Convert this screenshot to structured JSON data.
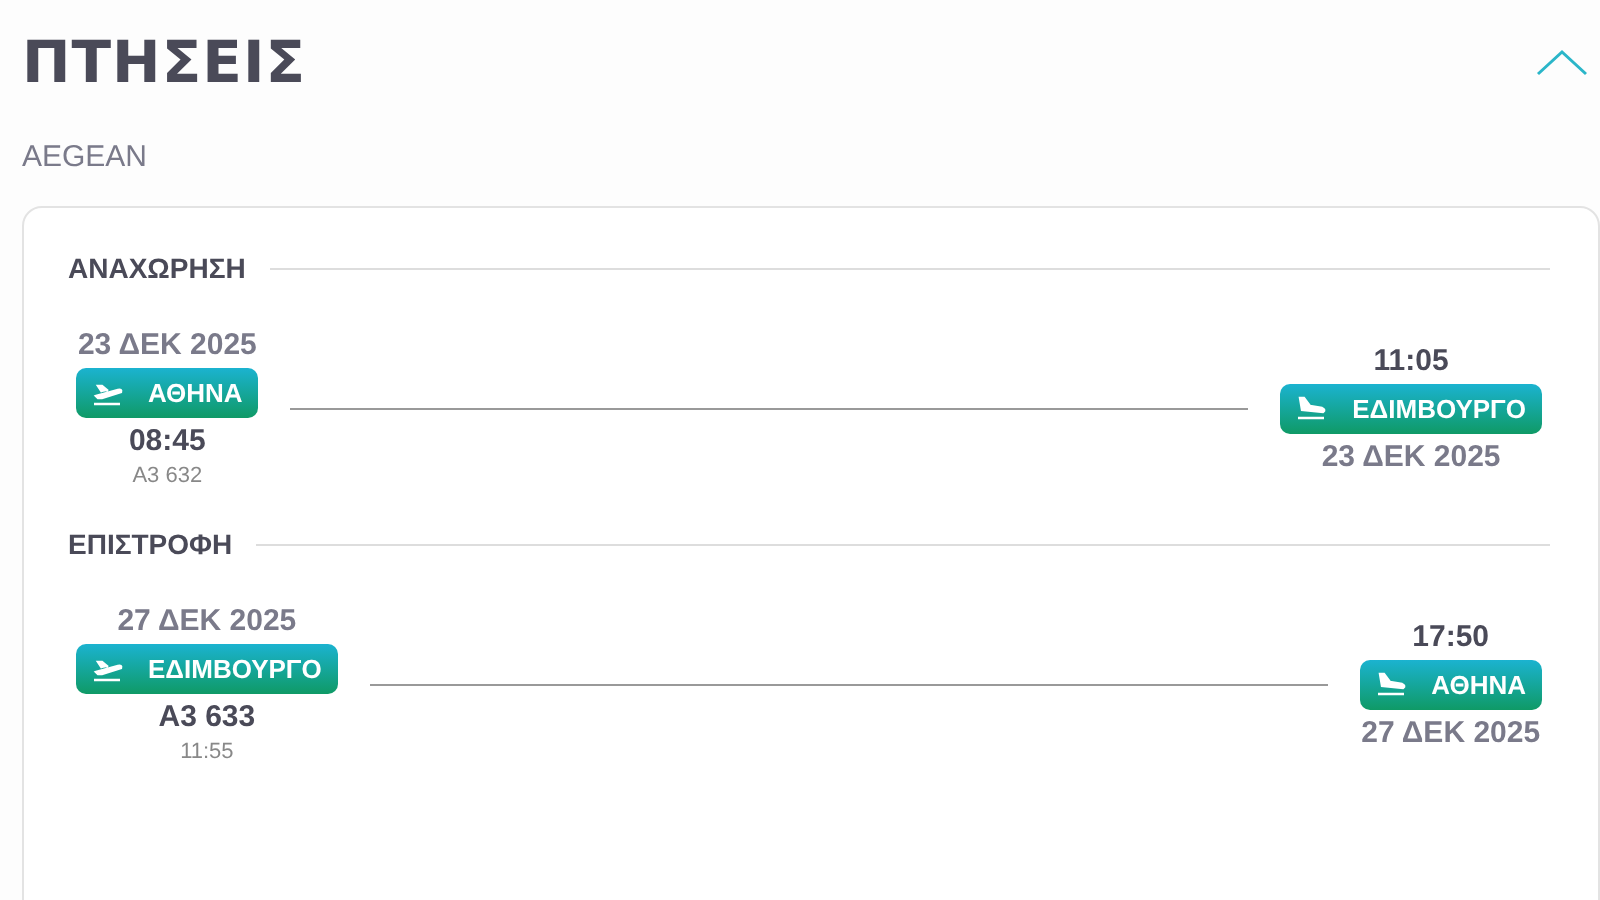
{
  "title": "ΠΤΗΣΕΙΣ",
  "expanded": true,
  "airline": "AEGEAN",
  "legs": [
    {
      "label": "ΑΝΑΧΩΡΗΣΗ",
      "departure": {
        "date": "23 ΔΕΚ 2025",
        "city": "ΑΘΗΝΑ",
        "primary": "08:45",
        "secondary": "A3 632"
      },
      "arrival": {
        "time": "11:05",
        "city": "ΕΔΙΜΒΟΥΡΓΟ",
        "date": "23 ΔΕΚ 2025"
      }
    },
    {
      "label": "ΕΠΙΣΤΡΟΦΗ",
      "departure": {
        "date": "27 ΔΕΚ 2025",
        "city": "ΕΔΙΜΒΟΥΡΓΟ",
        "primary": "A3 633",
        "secondary": "11:55"
      },
      "arrival": {
        "time": "17:50",
        "city": "ΑΘΗΝΑ",
        "date": "27 ΔΕΚ 2025"
      }
    }
  ]
}
